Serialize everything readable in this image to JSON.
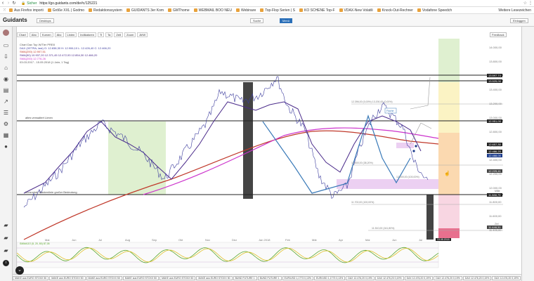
{
  "browser": {
    "secure_label": "Sicher",
    "url": "https://go.guidants.com/de#c/125221",
    "bookmarks": [
      {
        "label": "Aus Firefox importi"
      },
      {
        "label": "Größe XXL | Godmo"
      },
      {
        "label": "Redaktionssystem"
      },
      {
        "label": "GUIDANTS 3er Kom"
      },
      {
        "label": "GMThome"
      },
      {
        "label": "WEBMAIL BOO NEU"
      },
      {
        "label": "Webinare"
      },
      {
        "label": "Top-Flop Serien | S"
      },
      {
        "label": "KO SCHENE Top-F"
      },
      {
        "label": "VDAX-New Volatili"
      },
      {
        "label": "Knock-Out-Rechner"
      },
      {
        "label": "Vodafone Speedch"
      }
    ],
    "other_bookmarks": "Weitere Lesezeichen"
  },
  "app": {
    "logo": "Guidants",
    "desktop_label": "Desktops",
    "search_label": "Suche",
    "menu_label": "Menü",
    "login_label": "Einloggen"
  },
  "toolbar": {
    "buttons": [
      "Chart",
      "Abo",
      "Kurven",
      "Abc",
      "Linien",
      "Indikatoren",
      "Ti",
      "Ta",
      "Zeit",
      "Zoom",
      "AVW"
    ],
    "feedback": "Feedback"
  },
  "legend": {
    "title": "Chart Dax Top W/Tier PRE8",
    "line1": "DAX (XETRA, last) O: 12.838,30  H: 12.906,10  L: 12.426,40  C: 12.466,20",
    "line2": "SMA(200) 12.907,51",
    "line3": "SMA(50) 10.937,20  12.371,45  12.472,93  12.854,30  12.466,20",
    "line4": "SMA(200) 12.776,26",
    "line5": "03.03.2017 - 15.05.2018 (1 Jahr, 1 Tag)"
  },
  "annotations": {
    "alter_widerstand": "altes verwaltert Limen",
    "unterstuetzung": "horizontal: Nackenlinie großer Bedeutung",
    "fib_top": "12.396,00 (0,00%)    13.200,00 (0,00%)",
    "fib_mid1": "12.500,00 (38,20%)",
    "fib_mid2": "12.000,00 (100,00%)",
    "fib_low1": "11.700,00 (100,00%)",
    "fib_low2": "11.510,00 (161,80%)",
    "label_mitte": "Mitte",
    "label_ziel": "Ziel",
    "pattern_label": "Flache"
  },
  "price_axis": {
    "ticks": [
      "14.000,00",
      "13.800,00",
      "13.600,00",
      "13.400,00",
      "13.200,00",
      "13.000,00",
      "12.800,00",
      "12.600,00",
      "12.400,00",
      "12.200,00",
      "12.000,00",
      "11.800,00",
      "11.600,00",
      "11.400,00"
    ],
    "tags": [
      {
        "text": "13.597,74",
        "color": "#222222"
      },
      {
        "text": "13.525,00",
        "color": "#222222"
      },
      {
        "text": "12.951,00",
        "color": "#222222"
      },
      {
        "text": "12.657,30",
        "color": "#222222"
      },
      {
        "text": "12.486,20",
        "color": "#222222"
      },
      {
        "text": "12.488,00",
        "color": "#1a3a8a"
      },
      {
        "text": "12.225,41",
        "color": "#444444"
      },
      {
        "text": "11.888,75",
        "color": "#222222"
      },
      {
        "text": "11.448,31",
        "color": "#444444"
      }
    ]
  },
  "time_axis": {
    "labels": [
      "Mai",
      "Jun",
      "Jul",
      "Aug",
      "Sep",
      "Okt",
      "Nov",
      "Dez",
      "Jan 2018",
      "Feb",
      "Mär",
      "Apr",
      "Mai",
      "Jun",
      "Jul"
    ]
  },
  "date_badge": "13.08.2018",
  "indicator": {
    "label": "SMMAGO (5, 20, 80) 87,05",
    "ticks": [
      "100",
      "80",
      "20"
    ]
  },
  "bottom_tabs": [
    "MAKE aus EURO STOXX 50",
    "MAKE aus EURO STOXX 50",
    "MAKE aus EURO STOXX 50",
    "MAKE aus EURO STOXX 50",
    "MAKE aus EURO STOXX 50",
    "MAKE aus EURO STOXX 50",
    "BUND FUTURE 1",
    "BUND FUTURE 1",
    "EUR/USD 1,1773 0,13%",
    "EUR/USD 1,1773 0,13%",
    "DAX 12.476,20 0,19%",
    "DAX 12.476,20 0,19%",
    "DAX 12.476,20 0,19%",
    "DAX 12.476,20 0,19%",
    "DAX 12.476,20 0,19%",
    "DAX 12.476,20 0,19%",
    "DAX 12.476,20 0,19%",
    "DAX 12.476,20 0,19%"
  ],
  "bottom_right": [
    "BÖRSENPLATZ",
    "PORTFOLIO",
    "STRATEGIE",
    "ABO",
    "HILFE"
  ],
  "colors": {
    "price": "#3d3d9e",
    "trend_blue": "#3a7ab8",
    "sma200": "#c0392b",
    "sma_magenta": "#cc33cc",
    "ema_purple": "#4a2a8a",
    "green_zone": "#dff0d0",
    "orange_zone": "#fbd9b0",
    "pink_zone": "#f6c8d6",
    "lila_zone": "#e8c8f0"
  }
}
